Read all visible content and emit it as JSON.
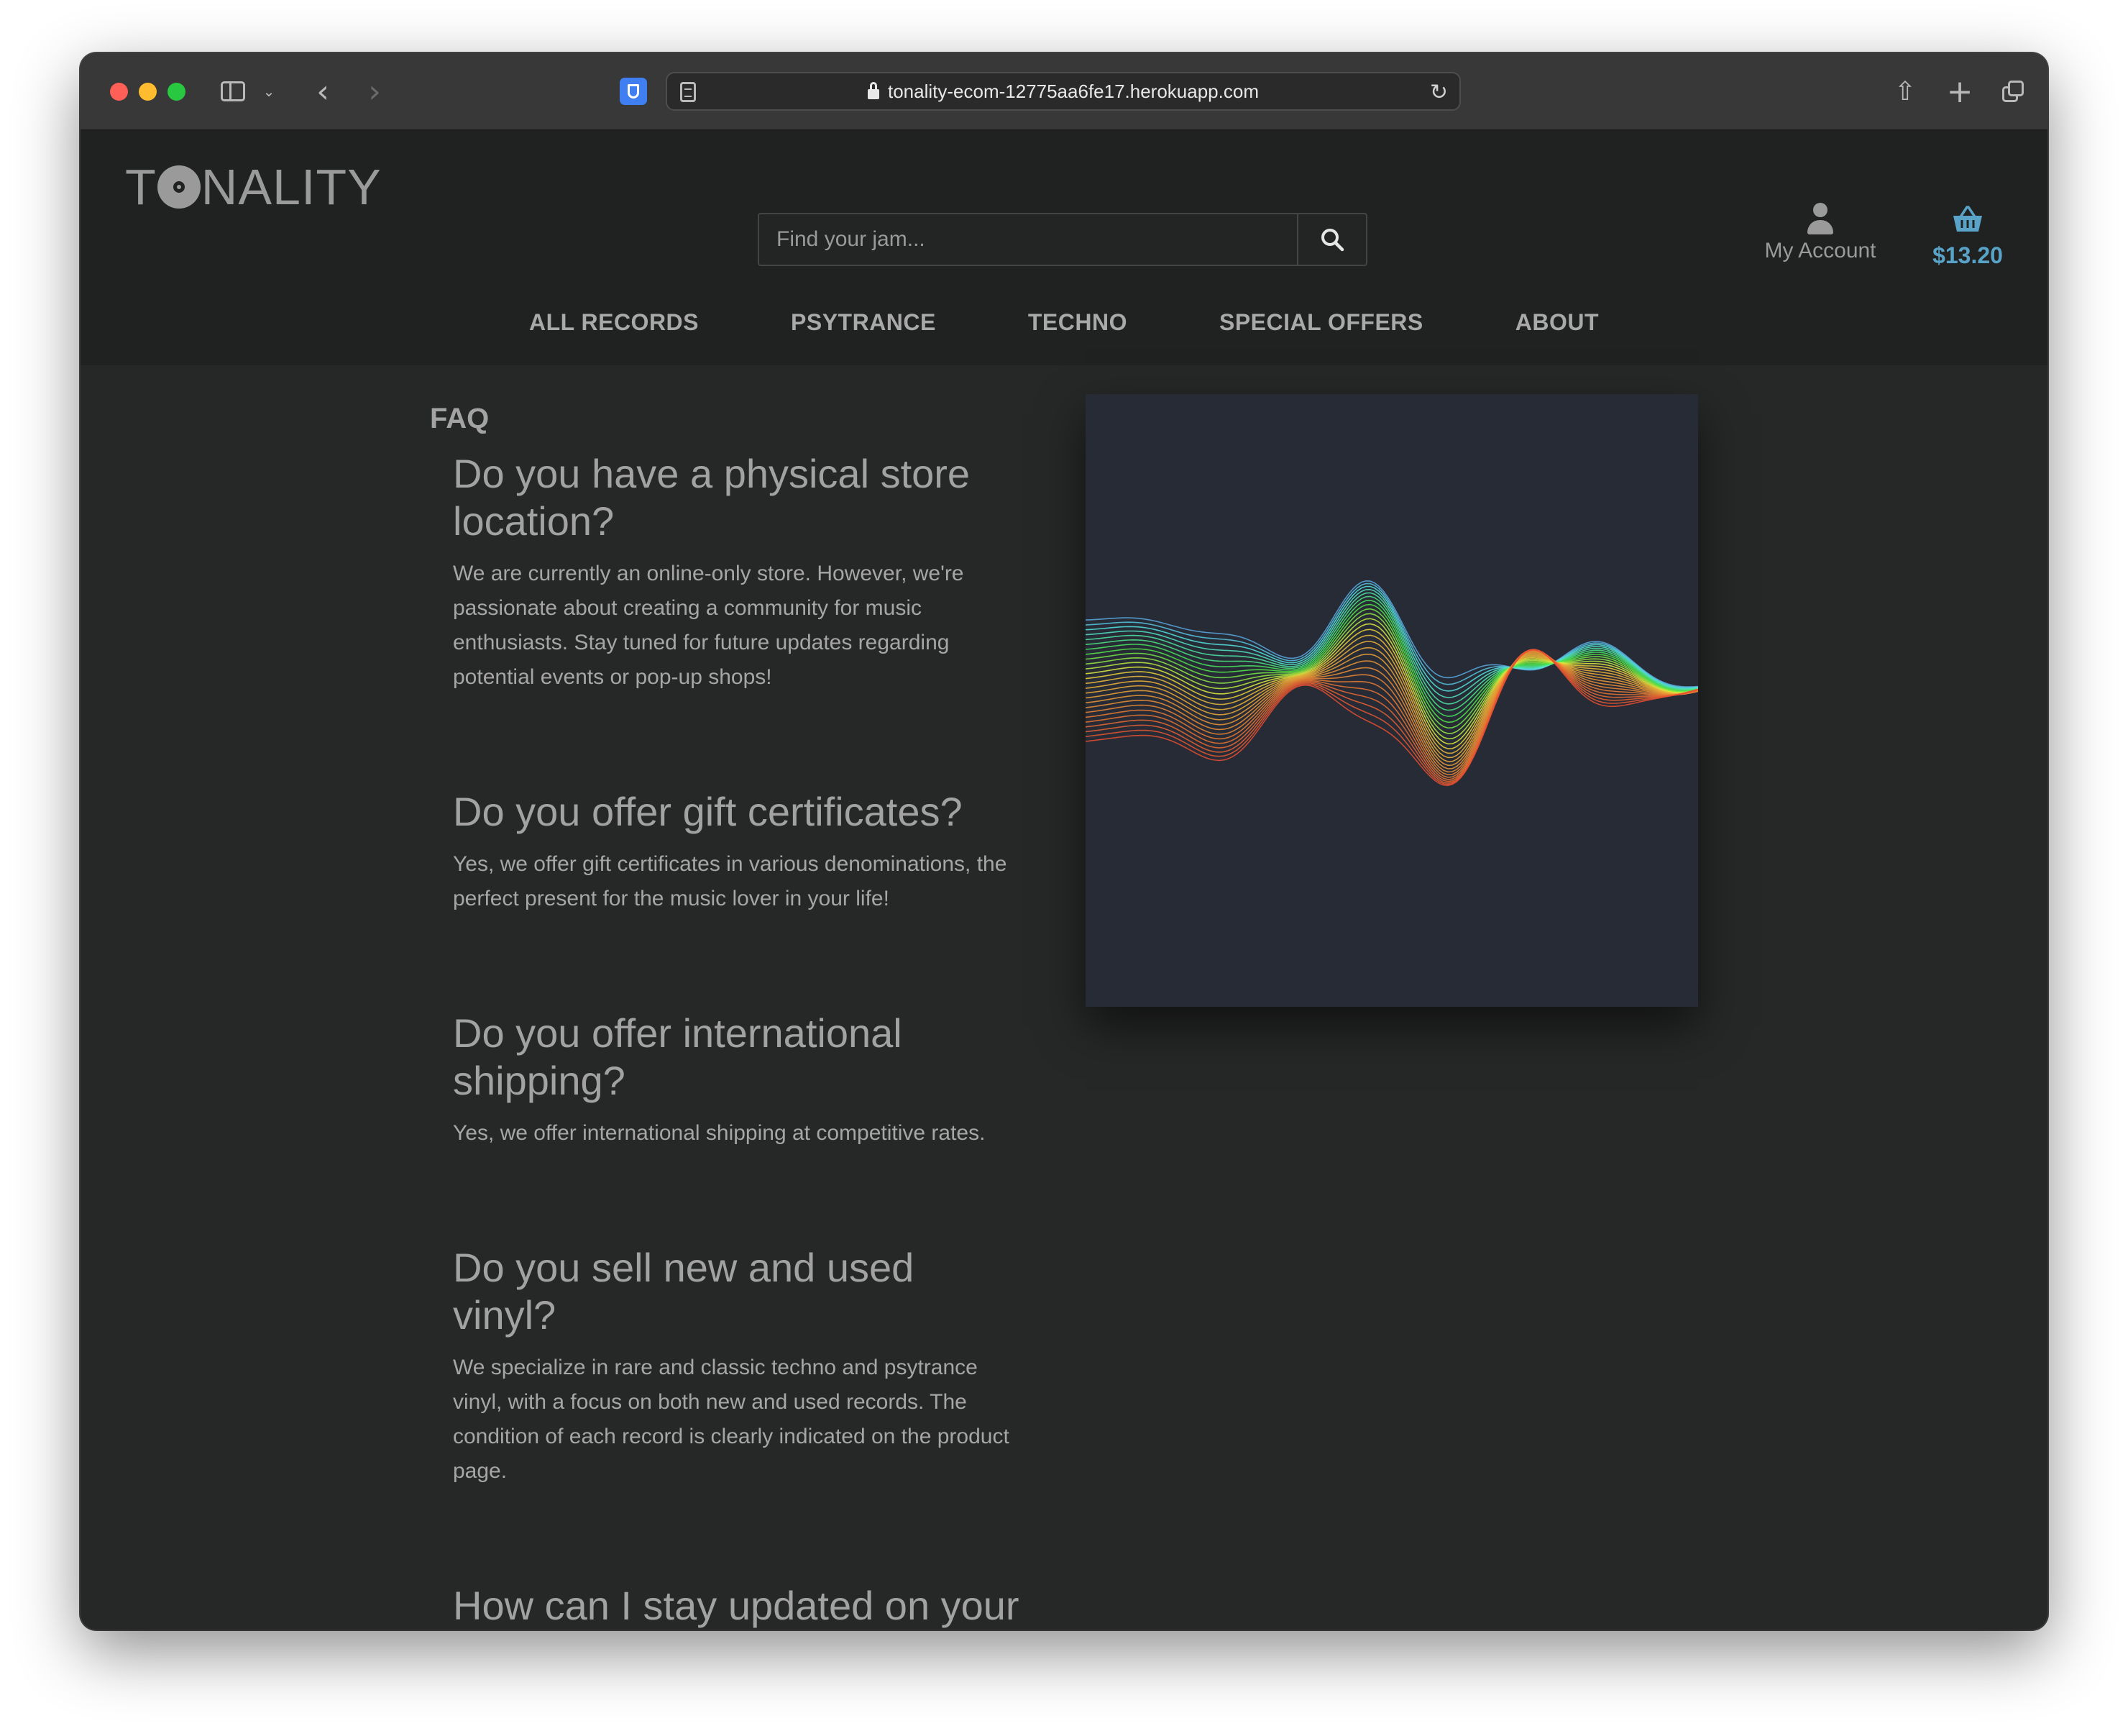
{
  "browser": {
    "url": "tonality-ecom-12775aa6fe17.herokuapp.com"
  },
  "header": {
    "logo_pre": "T",
    "logo_post": "NALITY",
    "search_placeholder": "Find your jam...",
    "account_label": "My Account",
    "cart_total": "$13.20",
    "accent_color": "#5aa3c8"
  },
  "nav": {
    "items": [
      "ALL RECORDS",
      "PSYTRANCE",
      "TECHNO",
      "SPECIAL OFFERS",
      "ABOUT"
    ]
  },
  "page": {
    "heading": "FAQ",
    "faqs": [
      {
        "q": "Do you have a physical store location?",
        "a": "We are currently an online-only store. However, we're passionate about creating a community for music enthusiasts. Stay tuned for future updates regarding potential events or pop-up shops!"
      },
      {
        "q": "Do you offer gift certificates?",
        "a": "Yes, we offer gift certificates in various denominations, the perfect present for the music lover in your life!"
      },
      {
        "q": "Do you offer international shipping?",
        "a": "Yes, we offer international shipping at competitive rates."
      },
      {
        "q": "Do you sell new and used vinyl?",
        "a": "We specialize in rare and classic techno and psytrance vinyl, with a focus on both new and used records. The condition of each record is clearly indicated on the product page."
      },
      {
        "q": "How can I stay updated on your latest arrivals and promotions?",
        "a": ""
      }
    ]
  }
}
